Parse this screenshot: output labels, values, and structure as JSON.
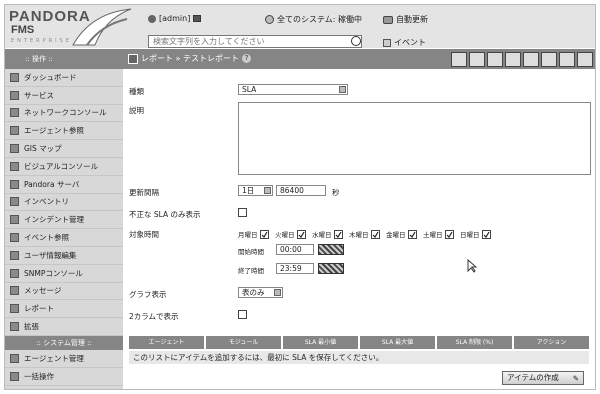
{
  "header": {
    "brand": "PANDORA",
    "product": "FMS",
    "tagline": "ENTERPRISE",
    "user": "[admin]",
    "status": "全てのシステム: 稼働中",
    "refresh": "自動更新",
    "search_placeholder": "検索文字列を入力してください",
    "events": "イベント"
  },
  "subbar": {
    "menu_title": ":: 操作 ::",
    "breadcrumb": "レポート » テストレポート",
    "help": "?"
  },
  "toolbar_icons": [
    "list-icon",
    "star-icon",
    "eye-icon",
    "chart-icon",
    "wrench-icon",
    "wrench-icon",
    "copy-icon",
    "copy-icon"
  ],
  "sidebar": {
    "items_top": [
      {
        "label": "ダッシュボード",
        "icon": "dashboard-icon"
      },
      {
        "label": "サービス",
        "icon": "services-icon"
      },
      {
        "label": "ネットワークコンソール",
        "icon": "network-icon"
      },
      {
        "label": "エージェント参照",
        "icon": "agent-icon"
      },
      {
        "label": "GIS マップ",
        "icon": "globe-icon"
      },
      {
        "label": "ビジュアルコンソール",
        "icon": "visual-icon"
      },
      {
        "label": "Pandora サーバ",
        "icon": "server-icon"
      },
      {
        "label": "インベントリ",
        "icon": "inventory-icon"
      },
      {
        "label": "インシデント管理",
        "icon": "incident-icon"
      },
      {
        "label": "イベント参照",
        "icon": "event-icon"
      },
      {
        "label": "ユーザ情報編集",
        "icon": "user-icon"
      },
      {
        "label": "SNMPコンソール",
        "icon": "snmp-icon"
      },
      {
        "label": "メッセージ",
        "icon": "mail-icon"
      },
      {
        "label": "レポート",
        "icon": "report-icon"
      },
      {
        "label": "拡張",
        "icon": "extension-icon"
      }
    ],
    "section": ":: システム管理 ::",
    "items_bottom": [
      {
        "label": "エージェント管理",
        "icon": "agent-manage-icon"
      },
      {
        "label": "一括操作",
        "icon": "bulk-icon"
      }
    ]
  },
  "form": {
    "type_label": "種類",
    "type_value": "SLA",
    "description_label": "説明",
    "interval_label": "更新間隔",
    "interval_unit_value": "1日",
    "interval_seconds": "86400",
    "interval_suffix": "秒",
    "only_invalid_label": "不正な SLA のみ表示",
    "period_label": "対象時間",
    "days": [
      "月曜日",
      "火曜日",
      "水曜日",
      "木曜日",
      "金曜日",
      "土曜日",
      "日曜日"
    ],
    "start_label": "開始時間",
    "start_value": "00:00",
    "end_label": "終了時間",
    "end_value": "23:59",
    "graph_label": "グラフ表示",
    "graph_value": "表のみ",
    "two_col_label": "2カラムで表示"
  },
  "table": {
    "headers": [
      "エージェント",
      "モジュール",
      "SLA 最小値",
      "SLA 最大値",
      "SLA 制限 (%)",
      "アクション"
    ],
    "notice": "このリストにアイテムを追加するには、最初に SLA を保存してください。"
  },
  "create_button": "アイテムの作成"
}
